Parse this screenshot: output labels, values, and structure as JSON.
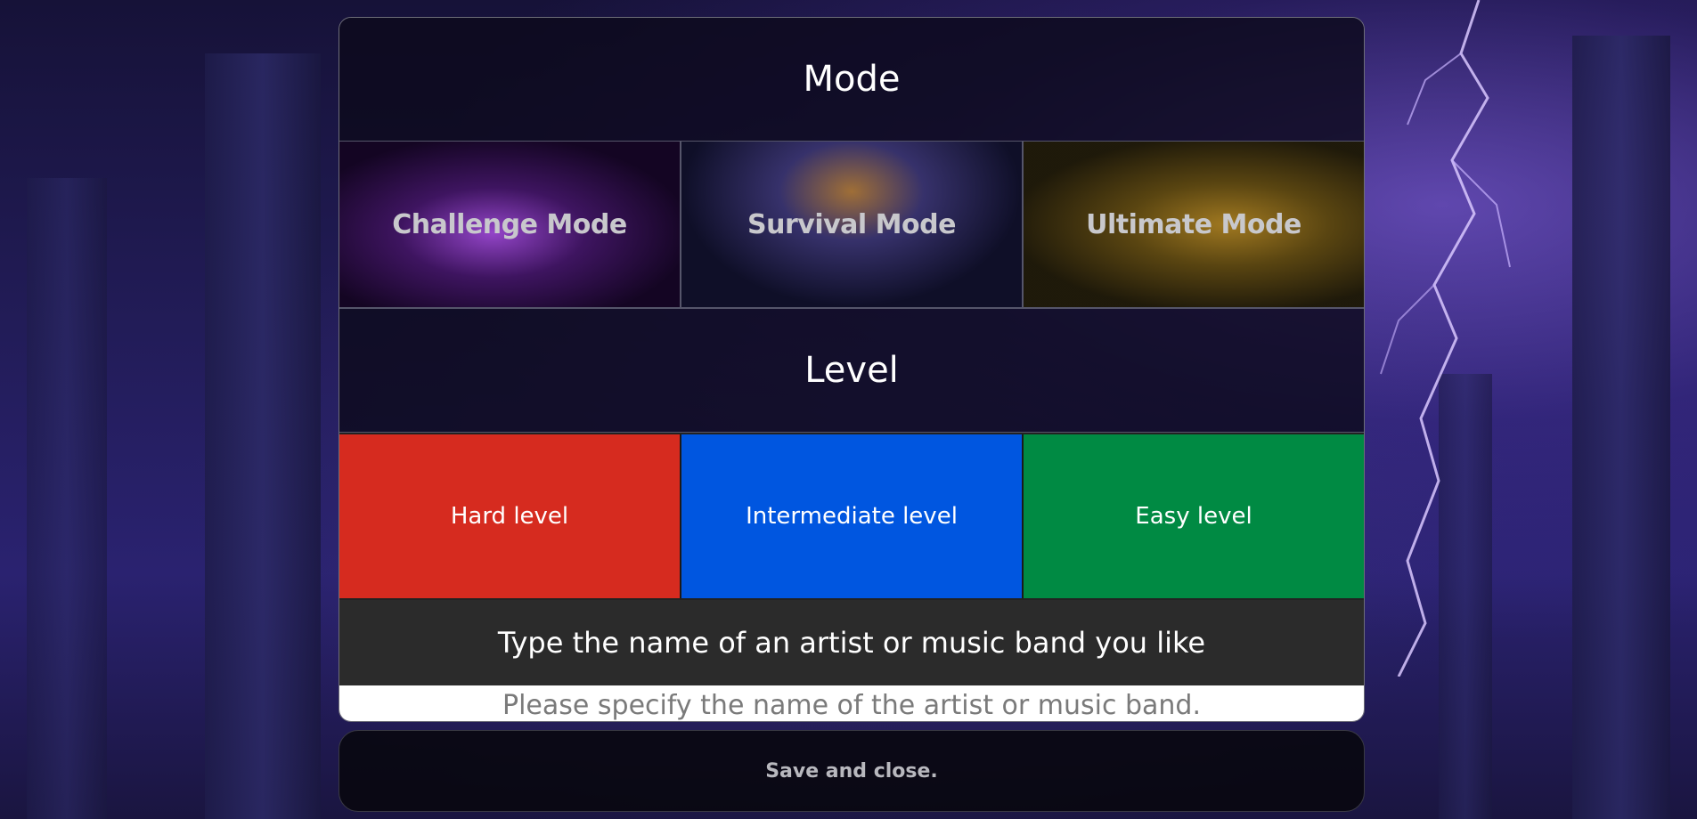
{
  "mode_section": {
    "title": "Mode",
    "options": [
      {
        "label": "Challenge Mode"
      },
      {
        "label": "Survival Mode"
      },
      {
        "label": "Ultimate Mode"
      }
    ]
  },
  "level_section": {
    "title": "Level",
    "options": [
      {
        "label": "Hard level",
        "color": "#d62b1f"
      },
      {
        "label": "Intermediate level",
        "color": "#0056e0"
      },
      {
        "label": "Easy level",
        "color": "#008a43"
      }
    ]
  },
  "artist": {
    "label": "Type the name of an artist or music band you like",
    "value": "",
    "placeholder": "Please specify the name of the artist or music band."
  },
  "save_button": {
    "label": "Save and close."
  }
}
